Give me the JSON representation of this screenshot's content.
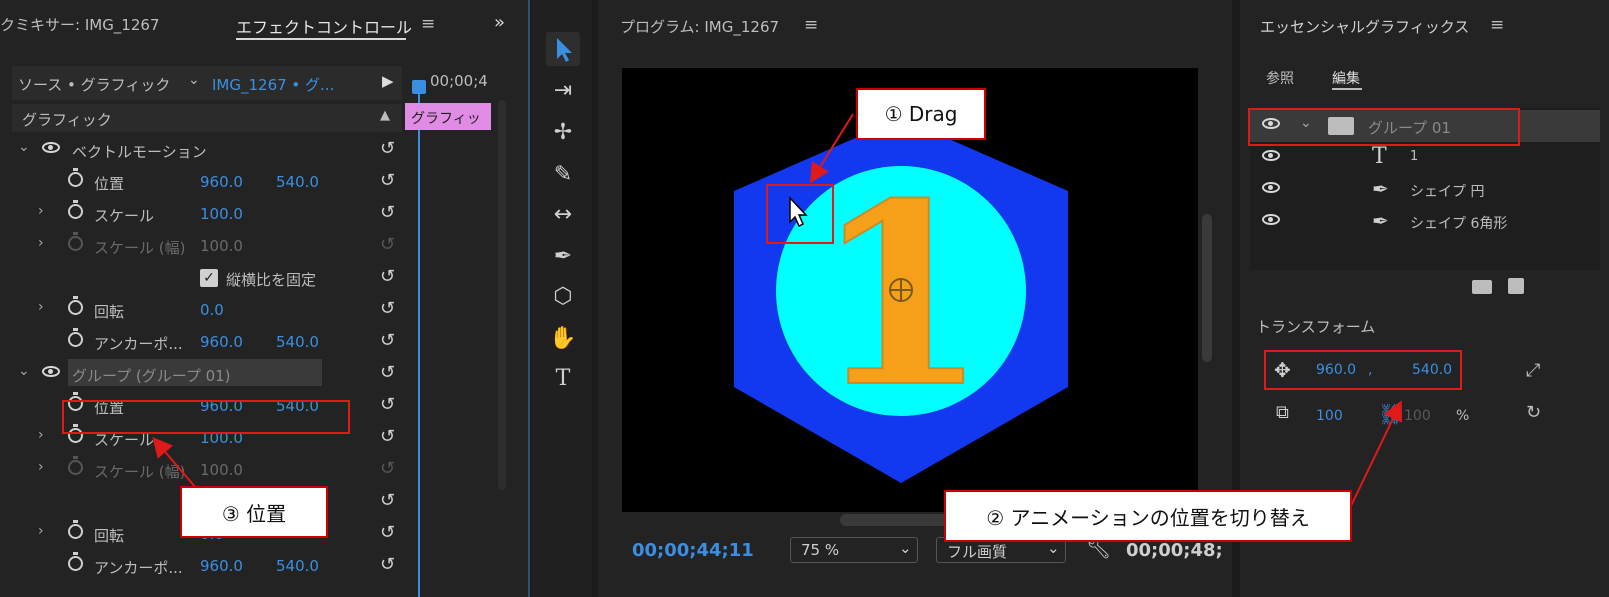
{
  "left_panel": {
    "tab_mixer": "クミキサー: IMG_1267",
    "tab_effect_controls": "エフェクトコントロール",
    "source_label": "ソース • グラフィック",
    "clip_label": "IMG_1267 • グ...",
    "timecode_partial": "00;00;4",
    "clip_bar_label": "グラフィッ",
    "section_graphic": "グラフィック",
    "vector_motion": "ベクトルモーション",
    "position_label": "位置",
    "position_x": "960.0",
    "position_y": "540.0",
    "scale_label": "スケール",
    "scale_value": "100.0",
    "scale_width_label": "スケール (幅)",
    "scale_width_value": "100.0",
    "uniform_scale_label": "縦横比を固定",
    "rotation_label": "回転",
    "rotation_value": "0.0",
    "anchor_label": "アンカーポ...",
    "anchor_x": "960.0",
    "anchor_y": "540.0",
    "group_label": "グループ (グループ 01)",
    "group_position_label": "位置",
    "group_position_x": "960.0",
    "group_position_y": "540.0",
    "group_scale_label": "スケール",
    "group_scale_value": "100.0",
    "group_scale_width_label": "スケール (幅)",
    "group_scale_width_value": "100.0",
    "group_rotation_label": "回転",
    "group_rotation_value": "0.0",
    "group_anchor_label": "アンカーポ...",
    "group_anchor_x": "960.0",
    "group_anchor_y": "540.0"
  },
  "program": {
    "title": "プログラム: IMG_1267",
    "timecode": "00;00;44;11",
    "zoom": "75 %",
    "quality": "フル画質",
    "duration": "00;00;48;",
    "graphic_number": "1"
  },
  "essential_graphics": {
    "title": "エッセンシャルグラフィックス",
    "tab_browse": "参照",
    "tab_edit": "編集",
    "layers": [
      {
        "name": "グループ 01",
        "type": "folder"
      },
      {
        "name": "1",
        "type": "text"
      },
      {
        "name": "シェイプ 円",
        "type": "shape"
      },
      {
        "name": "シェイプ 6角形",
        "type": "shape"
      }
    ],
    "transform_label": "トランスフォーム",
    "position_x": "960.0",
    "position_sep": ",",
    "position_y": "540.0",
    "scale": "100",
    "scale_width": "100",
    "percent": "%"
  },
  "callouts": {
    "drag": "① Drag",
    "toggle": "② アニメーションの位置を切り替え",
    "position": "③ 位置"
  },
  "colors": {
    "hexagon": "#1238f0",
    "circle": "#00ffff",
    "digit": "#f5a018",
    "accent_blue": "#3b8fe0",
    "annotation_red": "#e01919"
  }
}
